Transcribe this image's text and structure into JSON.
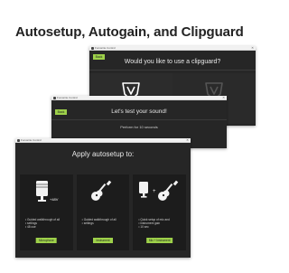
{
  "page": {
    "title": "Autosetup, Autogain, and Clipguard"
  },
  "window_clipguard": {
    "title": "Focusrite Control",
    "back_label": "Back",
    "heading": "Would you like to use a clipguard?"
  },
  "window_test": {
    "title": "Focusrite Control",
    "back_label": "Back",
    "heading": "Let's test your sound!",
    "subtext": "Perform for 10 seconds"
  },
  "window_autosetup": {
    "title": "Focusrite Control",
    "heading": "Apply autosetup to:",
    "cards": [
      {
        "icon": "microphone-icon",
        "badge": "+48V",
        "bullets": [
          "Guided walkthrough of all",
          "settings",
          "48 use"
        ],
        "button": "Microphone"
      },
      {
        "icon": "guitar-icon",
        "bullets": [
          "Guided walkthrough of all",
          "settings"
        ],
        "button": "Instrument"
      },
      {
        "icon": "mic-plus-guitar-icon",
        "plus": "+",
        "bullets": [
          "Quick setup of mic and",
          "instrument gain",
          "10 sec"
        ],
        "button": "Mic + Instrument"
      }
    ]
  },
  "colors": {
    "accent": "#9ed14a",
    "window_bg": "#262626",
    "card_bg": "#1c1c1c",
    "titlebar": "#f1f1f1"
  }
}
